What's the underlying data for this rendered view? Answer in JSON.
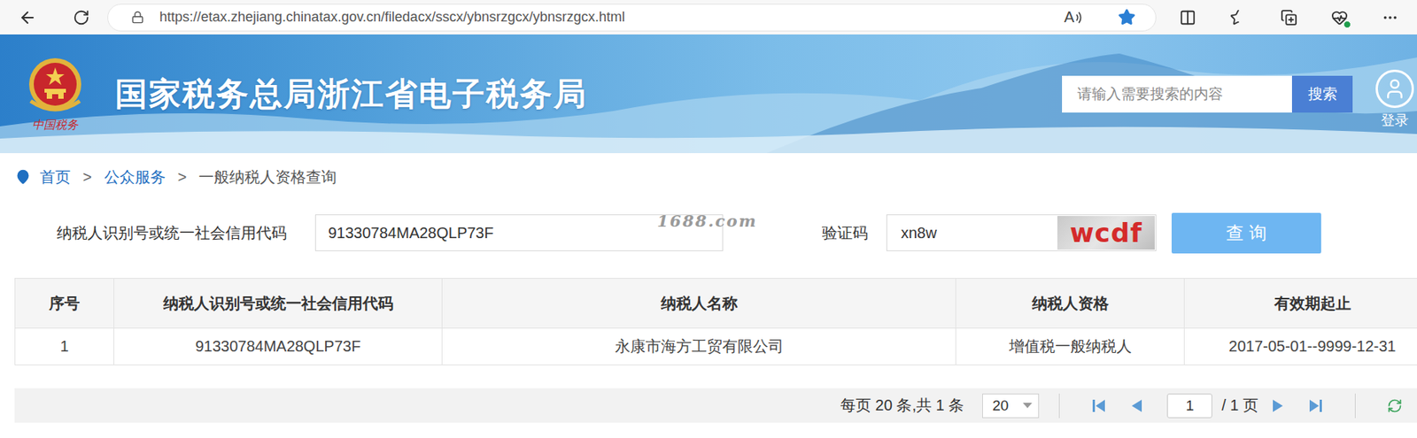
{
  "browser": {
    "url": "https://etax.zhejiang.chinatax.gov.cn/filedacx/sscx/ybnsrzgcx/ybnsrzgcx.html",
    "read_aloud": "A",
    "favorited": true
  },
  "header": {
    "logo_caption": "中国税务",
    "title": "国家税务总局浙江省电子税务局",
    "search_placeholder": "请输入需要搜索的内容",
    "search_button": "搜索",
    "login": "登录"
  },
  "breadcrumb": {
    "separator": ">",
    "items": [
      {
        "label": "首页",
        "link": true
      },
      {
        "label": "公众服务",
        "link": true
      },
      {
        "label": "一般纳税人资格查询",
        "link": false
      }
    ]
  },
  "query": {
    "id_label": "纳税人识别号或统一社会信用代码",
    "id_value": "91330784MA28QLP73F",
    "captcha_label": "验证码",
    "captcha_value": "xn8w",
    "captcha_image": "wcdf",
    "button": "查 询"
  },
  "watermark": "1688.com",
  "table": {
    "columns": [
      "序号",
      "纳税人识别号或统一社会信用代码",
      "纳税人名称",
      "纳税人资格",
      "有效期起止"
    ],
    "rows": [
      [
        "1",
        "91330784MA28QLP73F",
        "永康市海方工贸有限公司",
        "增值税一般纳税人",
        "2017-05-01--9999-12-31"
      ]
    ]
  },
  "pagination": {
    "summary": "每页 20 条,共 1 条",
    "page_size": "20",
    "page": "1",
    "total": "/ 1 页"
  }
}
